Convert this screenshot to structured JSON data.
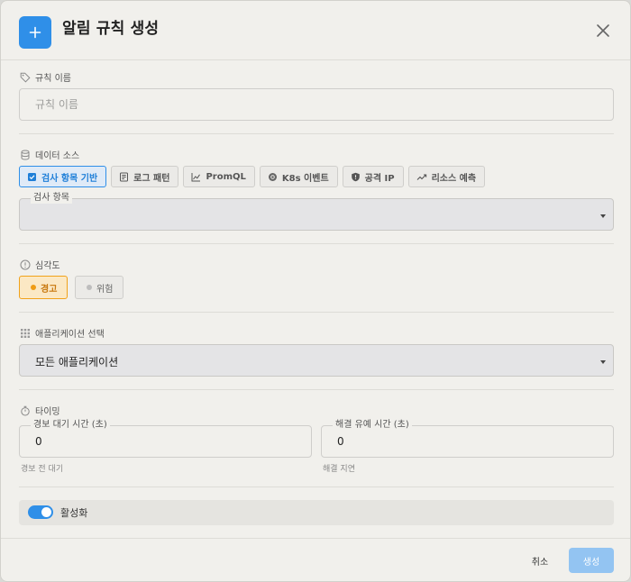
{
  "header": {
    "title": "알림 규칙 생성",
    "icon": "plus-icon"
  },
  "rule_name": {
    "label": "규칙 이름",
    "placeholder": "규칙 이름",
    "value": ""
  },
  "data_source": {
    "label": "데이터 소스",
    "options": [
      {
        "label": "검사 항목 기반",
        "icon": "checklist-icon",
        "selected": true
      },
      {
        "label": "로그 패턴",
        "icon": "log-icon",
        "selected": false
      },
      {
        "label": "PromQL",
        "icon": "line-chart-icon",
        "selected": false
      },
      {
        "label": "K8s 이벤트",
        "icon": "kubernetes-icon",
        "selected": false
      },
      {
        "label": "공격 IP",
        "icon": "shield-icon",
        "selected": false
      },
      {
        "label": "리소스 예측",
        "icon": "trend-icon",
        "selected": false
      }
    ],
    "check_item": {
      "label": "검사 항목",
      "value": ""
    }
  },
  "severity": {
    "label": "심각도",
    "options": [
      {
        "label": "경고",
        "selected": true
      },
      {
        "label": "위험",
        "selected": false
      }
    ]
  },
  "application": {
    "label": "애플리케이션 선택",
    "value": "모든 애플리케이션"
  },
  "timing": {
    "label": "타이밍",
    "alert_wait": {
      "label": "경보 대기 시간 (초)",
      "value": "0",
      "helper": "경보 전 대기"
    },
    "resolve_grace": {
      "label": "해결 유예 시간 (초)",
      "value": "0",
      "helper": "해결 지연"
    }
  },
  "enabled": {
    "label": "활성화",
    "on": true
  },
  "footer": {
    "cancel": "취소",
    "create": "생성"
  },
  "colors": {
    "accent": "#2f8fe8",
    "warning": "#ef9c14",
    "create_disabled": "#93c4f2"
  }
}
